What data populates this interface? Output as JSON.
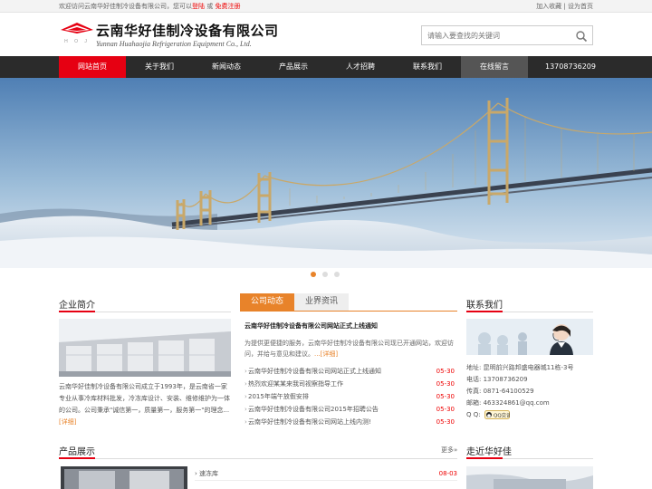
{
  "topbar": {
    "welcome": "欢迎访问云南华好佳制冷设备有限公司，您可以",
    "login": "登陆",
    "or": " 或 ",
    "register": "免费注册",
    "favorite": "加入收藏",
    "sep": " | ",
    "homepage": "设为首页"
  },
  "header": {
    "company_cn": "云南华好佳制冷设备有限公司",
    "company_en": "Yunnan Huahaojia Refrigeration Equipment Co., Ltd.",
    "logo_letters": "H O J",
    "search_placeholder": "请输入要查找的关键词"
  },
  "nav": {
    "items": [
      {
        "label": "网站首页"
      },
      {
        "label": "关于我们"
      },
      {
        "label": "新闻动态"
      },
      {
        "label": "产品展示"
      },
      {
        "label": "人才招聘"
      },
      {
        "label": "联系我们"
      },
      {
        "label": "在线留言"
      }
    ],
    "phone": "13708736209"
  },
  "about": {
    "title": "企业简介",
    "text": "云南华好佳制冷设备有限公司成立于1993年，是云南省一家专业从事冷库材料批发，冷冻库设计、安装、维修维护为一体的公司。公司秉承\"诚信第一，质量第一，服务第一\"的理念...",
    "more": "[详细]"
  },
  "news": {
    "tab_active": "公司动态",
    "tab_other": "业界资讯",
    "headline": "云南华好佳制冷设备有限公司网站正式上线通知",
    "summary": "为提供更便捷的服务，云南华好佳制冷设备有限公司现已开通网站，欢迎访问，并给与意见和建议。",
    "summary_more": "...[详细]",
    "items": [
      {
        "title": "云南华好佳制冷设备有限公司网站正式上线通知",
        "date": "05-30"
      },
      {
        "title": "热烈欢迎某某来我司视察指导工作",
        "date": "05-30"
      },
      {
        "title": "2015年端午放假安排",
        "date": "05-30"
      },
      {
        "title": "云南华好佳制冷设备有限公司2015年招聘公告",
        "date": "05-30"
      },
      {
        "title": "云南华好佳制冷设备有限公司网站上线内测!",
        "date": "05-30"
      }
    ]
  },
  "contact": {
    "title": "联系我们",
    "address_label": "地址:",
    "address": "昆明前兴路邦盛电器城11栋-3号",
    "phone_label": "电话:",
    "phone": "13708736209",
    "fax_label": "传真:",
    "fax": "0871-64100529",
    "email_label": "邮箱:",
    "email": "463324861@qq.com",
    "qq_label": "Q Q:",
    "qq_button": "QQ交谈"
  },
  "products": {
    "title": "产品展示",
    "more": "更多»",
    "items": [
      {
        "title": "速冻库",
        "date": "08-03"
      }
    ]
  },
  "near": {
    "title": "走近华好佳"
  },
  "colors": {
    "accent_red": "#e60012",
    "accent_orange": "#e8832a",
    "nav_bg": "#2b2b2b"
  }
}
